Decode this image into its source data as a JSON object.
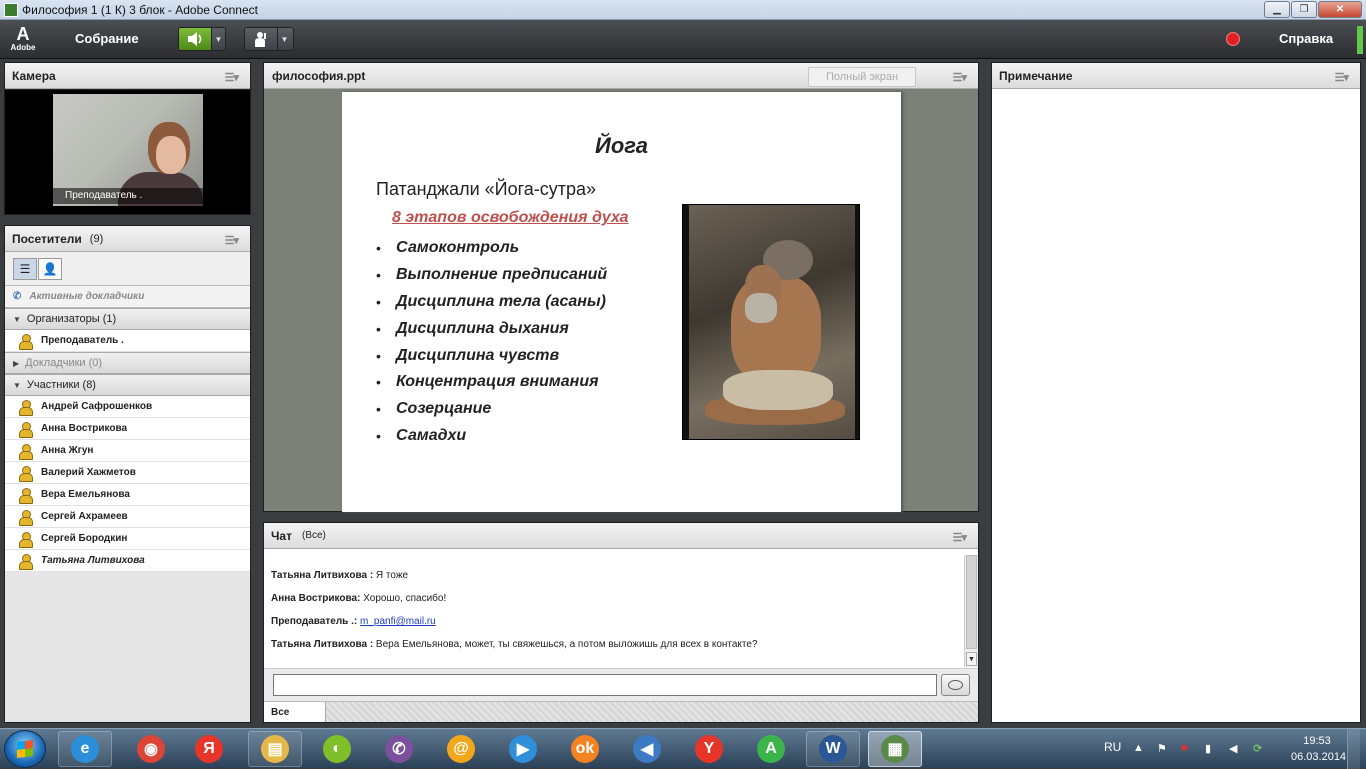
{
  "window": {
    "title": "Философия 1 (1 К) 3 блок - Adobe Connect",
    "minimize": "▁",
    "maximize": "❐",
    "close": "✕"
  },
  "menubar": {
    "logo_mark": "A",
    "logo_word": "Adobe",
    "meeting_menu": "Собрание",
    "help_menu": "Справка",
    "speaker_icon": "speaker-on",
    "camera_icon": "raise-hand",
    "record_color": "#e02020"
  },
  "camera_pod": {
    "title": "Камера",
    "video_label": "Преподаватель ."
  },
  "attendees_pod": {
    "title": "Посетители",
    "count": "(9)",
    "active_speakers": "Активные докладчики",
    "groups": [
      {
        "label": "Организаторы (1)",
        "members": [
          "Преподаватель ."
        ]
      },
      {
        "label": "Докладчики (0)",
        "members": []
      },
      {
        "label": "Участники (8)",
        "members": [
          "Андрей Сафрошенков",
          "Анна Вострикова",
          "Анна Жгун",
          "Валерий Хажметов",
          "Вера Емельянова",
          "Сергей Ахрамеев",
          "Сергей Бородкин",
          "Татьяна Литвихова"
        ]
      }
    ]
  },
  "share_pod": {
    "title": "философия.ppt",
    "fullscreen_label": "Полный экран",
    "slide": {
      "title": "Йога",
      "subtitle": "Патанджали «Йога-сутра»",
      "stages": "8 этапов освобождения духа",
      "bullet": "•",
      "items": [
        "Самоконтроль",
        "Выполнение предписаний",
        "Дисциплина тела (асаны)",
        "Дисциплина дыхания",
        "Дисциплина чувств",
        "Концентрация внимания",
        "Созерцание",
        "Самадхи"
      ]
    }
  },
  "chat_pod": {
    "title": "Чат",
    "audience": "(Все)",
    "messages": [
      {
        "who": "Татьяна Литвихова :",
        "text": " Я тоже"
      },
      {
        "who": "Анна Вострикова:",
        "text": " Хорошо, спасибо!"
      },
      {
        "who": "Преподаватель .:",
        "text": " ",
        "link": "m_panfi@mail.ru"
      },
      {
        "who": "Татьяна Литвихова :",
        "text": " Вера Емельянова, может, ты свяжешься, а потом выложишь для всех в контакте?"
      }
    ],
    "input_value": "",
    "tab_all": "Все"
  },
  "notes_pod": {
    "title": "Примечание"
  },
  "taskbar": {
    "apps": [
      {
        "name": "internet-explorer",
        "glyph": "e",
        "color": "#2a8fd8"
      },
      {
        "name": "chrome",
        "glyph": "◉",
        "color": "#db4437"
      },
      {
        "name": "yandex-browser",
        "glyph": "Я",
        "color": "#e8352a"
      },
      {
        "name": "file-explorer",
        "glyph": "▤",
        "color": "#e6b84a"
      },
      {
        "name": "green-app",
        "glyph": "◐",
        "color": "#7fbf2a"
      },
      {
        "name": "viber",
        "glyph": "✆",
        "color": "#7b519d"
      },
      {
        "name": "mail-agent",
        "glyph": "@",
        "color": "#f3a81b"
      },
      {
        "name": "media-player",
        "glyph": "▶",
        "color": "#2f8fd8"
      },
      {
        "name": "odnoklassniki",
        "glyph": "ok",
        "color": "#f58220"
      },
      {
        "name": "volume-app",
        "glyph": "◀",
        "color": "#3c7ac4"
      },
      {
        "name": "yandex",
        "glyph": "Y",
        "color": "#e8352a"
      },
      {
        "name": "green-a-app",
        "glyph": "A",
        "color": "#3bb54a"
      },
      {
        "name": "word",
        "glyph": "W",
        "color": "#2b5797"
      },
      {
        "name": "adobe-connect",
        "glyph": "▦",
        "color": "#5a8a4a"
      }
    ],
    "language": "RU",
    "time": "19:53",
    "date": "06.03.2014"
  }
}
